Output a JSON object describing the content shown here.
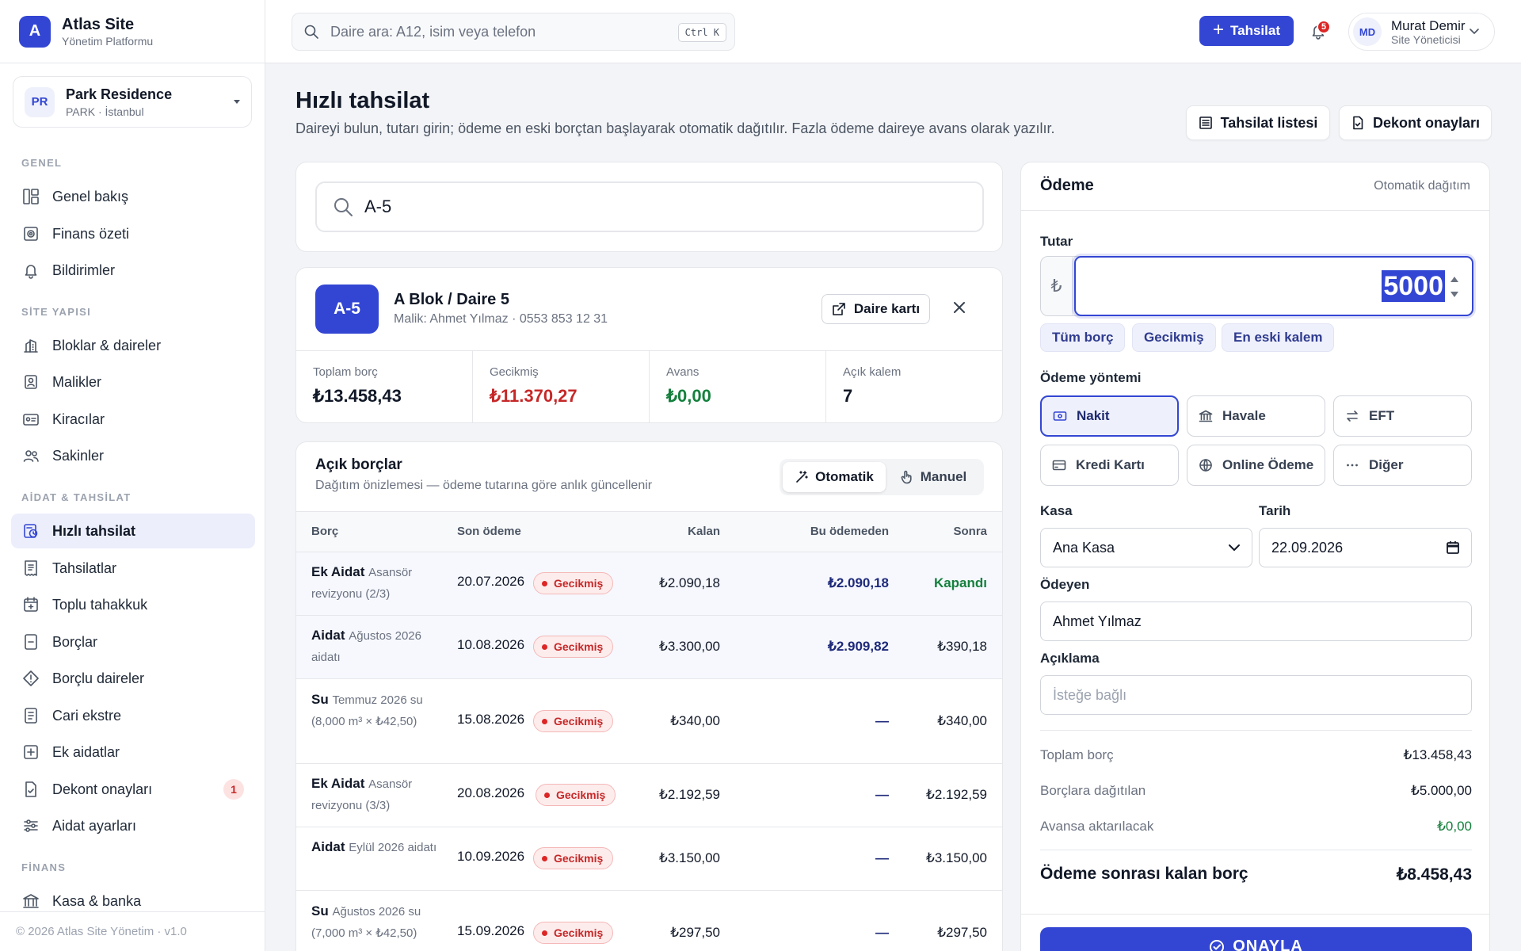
{
  "brand": {
    "logo": "A",
    "name": "Atlas Site",
    "sub": "Yönetim Platformu"
  },
  "site": {
    "badge": "PR",
    "name": "Park Residence",
    "sub": "PARK · İstanbul"
  },
  "nav": {
    "sections": [
      "GENEL",
      "SİTE YAPISI",
      "AİDAT & TAHSİLAT",
      "FİNANS"
    ],
    "items": [
      {
        "label": "Genel bakış",
        "icon": "dashboard-icon"
      },
      {
        "label": "Finans özeti",
        "icon": "finance-icon"
      },
      {
        "label": "Bildirimler",
        "icon": "bell-icon"
      },
      {
        "label": "Bloklar & daireler",
        "icon": "building-icon"
      },
      {
        "label": "Malikler",
        "icon": "owner-icon"
      },
      {
        "label": "Kiracılar",
        "icon": "id-card-icon"
      },
      {
        "label": "Sakinler",
        "icon": "users-icon"
      },
      {
        "label": "Hızlı tahsilat",
        "icon": "quick-pay-icon",
        "active": true
      },
      {
        "label": "Tahsilatlar",
        "icon": "receipt-icon"
      },
      {
        "label": "Toplu tahakkuk",
        "icon": "calendar-plus-icon"
      },
      {
        "label": "Borçlar",
        "icon": "debt-icon"
      },
      {
        "label": "Borçlu daireler",
        "icon": "alert-diamond-icon"
      },
      {
        "label": "Cari ekstre",
        "icon": "statement-icon"
      },
      {
        "label": "Ek aidatlar",
        "icon": "plus-square-icon"
      },
      {
        "label": "Dekont onayları",
        "icon": "doc-check-icon",
        "badge": "1"
      },
      {
        "label": "Aidat ayarları",
        "icon": "sliders-icon"
      },
      {
        "label": "Kasa & banka",
        "icon": "bank-icon"
      }
    ]
  },
  "footer": "© 2026 Atlas Site Yönetim · v1.0",
  "topbar": {
    "search_placeholder": "Daire ara: A12, isim veya telefon",
    "shortcut": "Ctrl K",
    "primary_button": "Tahsilat",
    "notif_count": "5",
    "user": {
      "initials": "MD",
      "name": "Murat Demir",
      "role": "Site Yöneticisi"
    }
  },
  "page": {
    "title": "Hızlı tahsilat",
    "description": "Daireyi bulun, tutarı girin; ödeme en eski borçtan başlayarak otomatik dağıtılır. Fazla ödeme daireye avans olarak yazılır.",
    "btn_list": "Tahsilat listesi",
    "btn_receipts": "Dekont onayları"
  },
  "unit_search": {
    "value": "A-5"
  },
  "unit": {
    "badge": "A-5",
    "title": "A Blok / Daire 5",
    "owner": "Malik: Ahmet Yılmaz · 0553 853 12 31",
    "card_button": "Daire kartı",
    "stats": [
      {
        "label": "Toplam borç",
        "value": "₺13.458,43",
        "color": "#111827"
      },
      {
        "label": "Gecikmiş",
        "value": "₺11.370,27",
        "color": "#c62828"
      },
      {
        "label": "Avans",
        "value": "₺0,00",
        "color": "#15803d"
      },
      {
        "label": "Açık kalem",
        "value": "7",
        "color": "#111827"
      }
    ]
  },
  "debts": {
    "title": "Açık borçlar",
    "subtitle": "Dağıtım önizlemesi — ödeme tutarına göre anlık güncellenir",
    "mode_auto": "Otomatik",
    "mode_manual": "Manuel",
    "columns": [
      "Borç",
      "Son ödeme",
      "Kalan",
      "Bu ödemeden",
      "Sonra"
    ],
    "status_label": "Gecikmiş",
    "rows": [
      {
        "type": "Ek Aidat",
        "desc": "Asansör revizyonu (2/3)",
        "due": "20.07.2026",
        "remaining": "₺2.090,18",
        "applied": "₺2.090,18",
        "after": "Kapandı",
        "highlight": true
      },
      {
        "type": "Aidat",
        "desc": "Ağustos 2026 aidatı",
        "due": "10.08.2026",
        "remaining": "₺3.300,00",
        "applied": "₺2.909,82",
        "after": "₺390,18",
        "highlight": true
      },
      {
        "type": "Su",
        "desc": "Temmuz 2026 su (8,000 m³ × ₺42,50)",
        "due": "15.08.2026",
        "remaining": "₺340,00",
        "applied": "—",
        "after": "₺340,00",
        "highlight": false
      },
      {
        "type": "Ek Aidat",
        "desc": "Asansör revizyonu (3/3)",
        "due": "20.08.2026",
        "remaining": "₺2.192,59",
        "applied": "—",
        "after": "₺2.192,59",
        "highlight": false
      },
      {
        "type": "Aidat",
        "desc": "Eylül 2026 aidatı",
        "due": "10.09.2026",
        "remaining": "₺3.150,00",
        "applied": "—",
        "after": "₺3.150,00",
        "highlight": false
      },
      {
        "type": "Su",
        "desc": "Ağustos 2026 su (7,000 m³ × ₺42,50)",
        "due": "15.09.2026",
        "remaining": "₺297,50",
        "applied": "—",
        "after": "₺297,50",
        "highlight": false
      }
    ]
  },
  "payment": {
    "title": "Ödeme",
    "mode": "Otomatik dağıtım",
    "amount_label": "Tutar",
    "currency": "₺",
    "amount": "5000",
    "chips": [
      "Tüm borç",
      "Gecikmiş",
      "En eski kalem"
    ],
    "method_label": "Ödeme yöntemi",
    "methods": [
      {
        "label": "Nakit",
        "icon": "cash-icon",
        "selected": true
      },
      {
        "label": "Havale",
        "icon": "bank-icon"
      },
      {
        "label": "EFT",
        "icon": "transfer-icon"
      },
      {
        "label": "Kredi Kartı",
        "icon": "credit-card-icon"
      },
      {
        "label": "Online Ödeme",
        "icon": "globe-icon"
      },
      {
        "label": "Diğer",
        "icon": "more-icon"
      }
    ],
    "cash_label": "Kasa",
    "cash_value": "Ana Kasa",
    "date_label": "Tarih",
    "date_value": "22.09.2026",
    "payer_label": "Ödeyen",
    "payer_value": "Ahmet Yılmaz",
    "note_label": "Açıklama",
    "note_placeholder": "İsteğe bağlı",
    "summary": [
      {
        "label": "Toplam borç",
        "value": "₺13.458,43"
      },
      {
        "label": "Borçlara dağıtılan",
        "value": "₺5.000,00"
      },
      {
        "label": "Avansa aktarılacak",
        "value": "₺0,00"
      }
    ],
    "remaining_label": "Ödeme sonrası kalan borç",
    "remaining_value": "₺8.458,43",
    "confirm": "ONAYLA"
  },
  "colors": {
    "accent": "#3346d3",
    "danger": "#c62828",
    "success": "#15803d"
  }
}
